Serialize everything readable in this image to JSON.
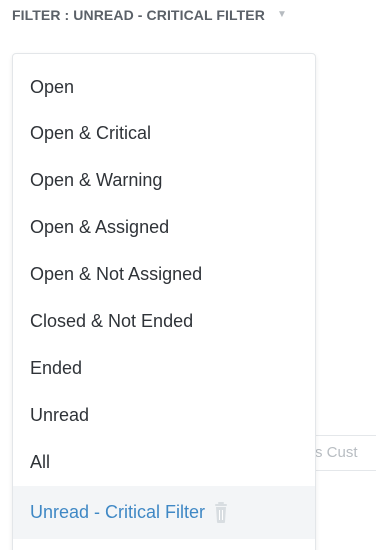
{
  "filter": {
    "label": "FILTER : UNREAD - CRITICAL FILTER",
    "caret_icon": "caret-down-icon"
  },
  "background_input": {
    "visible_text": "s Cust"
  },
  "menu": {
    "items": [
      {
        "label": "Open"
      },
      {
        "label": "Open & Critical"
      },
      {
        "label": "Open & Warning"
      },
      {
        "label": "Open & Assigned"
      },
      {
        "label": "Open & Not Assigned"
      },
      {
        "label": "Closed & Not Ended"
      },
      {
        "label": "Ended"
      },
      {
        "label": "Unread"
      },
      {
        "label": "All"
      },
      {
        "label": "Unread - Critical Filter",
        "selected": true,
        "icon": "trash-icon"
      }
    ]
  },
  "colors": {
    "text": "#2f3338",
    "header_text": "#5b6168",
    "selected_text": "#3f88c5",
    "selected_background": "#f3f5f7",
    "border": "#e3e6e9",
    "muted_icon": "#d8dde1"
  }
}
